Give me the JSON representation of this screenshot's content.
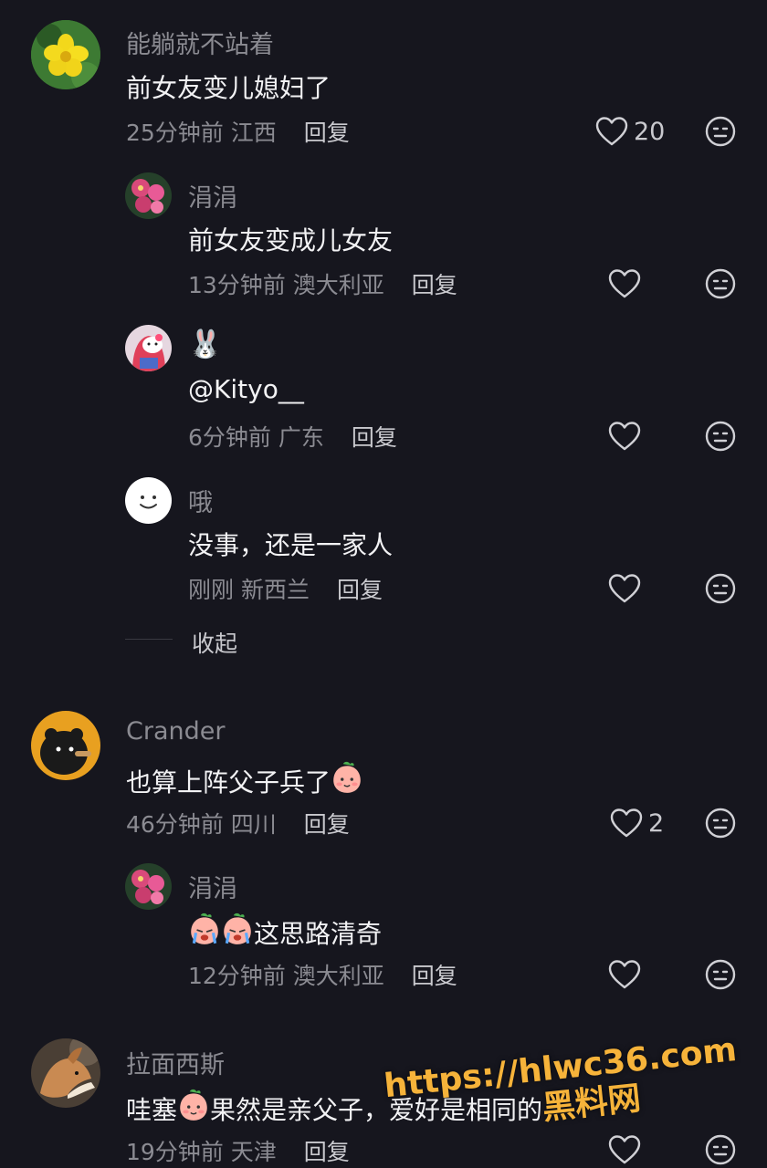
{
  "comments": [
    {
      "author": "能躺就不站着",
      "text": "前女友变儿媳妇了",
      "time": "25分钟前",
      "location": "江西",
      "reply_label": "回复",
      "likes": "20",
      "replies": [
        {
          "author": "涓涓",
          "text": "前女友变成儿女友",
          "time": "13分钟前",
          "location": "澳大利亚",
          "reply_label": "回复"
        },
        {
          "author": "🐰",
          "text": "@Kityo__",
          "time": "6分钟前",
          "location": "广东",
          "reply_label": "回复"
        },
        {
          "author": "哦",
          "text": "没事，还是一家人",
          "time": "刚刚",
          "location": "新西兰",
          "reply_label": "回复"
        }
      ],
      "collapse_label": "收起"
    },
    {
      "author": "Crander",
      "text": "也算上阵父子兵了",
      "time": "46分钟前",
      "location": "四川",
      "reply_label": "回复",
      "likes": "2",
      "replies": [
        {
          "author": "涓涓",
          "text": "这思路清奇",
          "time": "12分钟前",
          "location": "澳大利亚",
          "reply_label": "回复"
        }
      ]
    },
    {
      "author": "拉面西斯",
      "text_before": "哇塞",
      "text_after": "果然是亲父子，爱好是相同的",
      "time": "19分钟前",
      "location": "天津",
      "reply_label": "回复"
    }
  ],
  "watermark": {
    "url": "https://hlwc36.com",
    "brand": "黑料网"
  },
  "colors": {
    "background": "#16161e",
    "secondary_text": "#8b8b92",
    "primary_text": "#f2f2f4",
    "watermark": "#f6b33a"
  },
  "icons": [
    "heart-outline-icon",
    "dislike-face-icon",
    "smile-avatar",
    "peach-emoji",
    "crying-emoji"
  ]
}
